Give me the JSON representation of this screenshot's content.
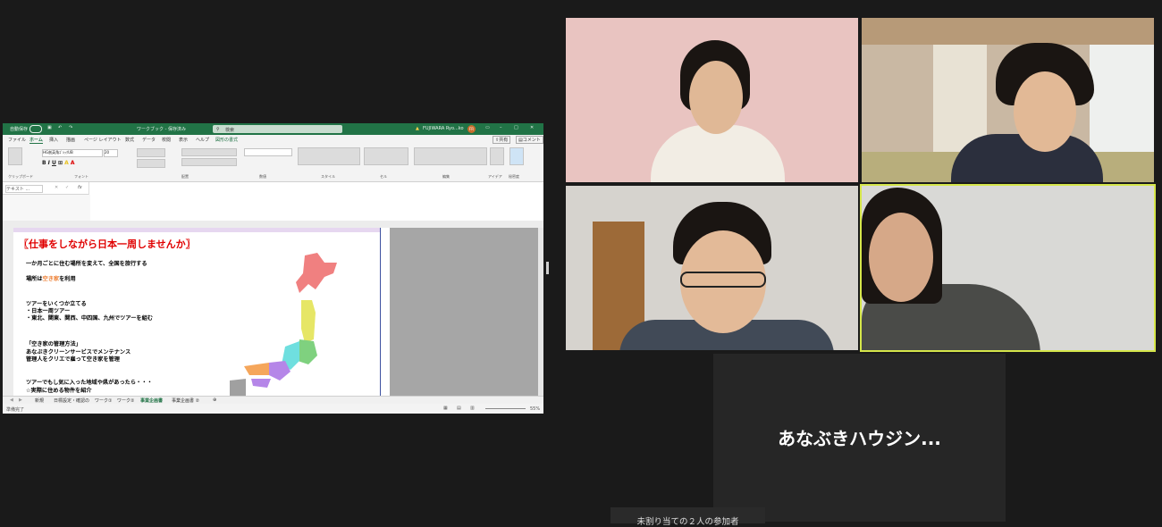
{
  "excel": {
    "autosave_label": "自動保存",
    "doc_title": "ワークブック - 保存済み",
    "search_placeholder": "検索",
    "user_name": "FUJIWARA Ryo...ko",
    "user_initials": "FR",
    "menu_tabs": [
      "ファイル",
      "ホーム",
      "挿入",
      "描画",
      "ページ レイアウト",
      "数式",
      "データ",
      "校閲",
      "表示",
      "ヘルプ",
      "図形の書式"
    ],
    "active_tab": "ホーム",
    "share_label": "共有",
    "comment_label": "コメント",
    "font_name": "HG創英角ｺﾞｼｯｸUB",
    "font_size": "20",
    "ribbon_groups": [
      "クリップボード",
      "フォント",
      "配置",
      "数値",
      "スタイル",
      "セル",
      "編集",
      "アイデア",
      "秘密度"
    ],
    "name_box": "テキスト ...",
    "fx_label": "fx",
    "sheet_headline": "〖仕事をしながら日本一周しませんか〗",
    "lines": {
      "l1": "一か月ごとに住む場所を変えて、全国を旅行する",
      "l2a": "場所は",
      "l2b": "空き家",
      "l2c": "を利用",
      "l3": "ツアーをいくつか立てる",
      "l4": "・日本一周ツアー",
      "l5": "・東北、関東、関西、中四国、九州でツアーを組む",
      "l6": "「空き家の管理方法」",
      "l7": "あなぶきクリーンサービスでメンテナンス",
      "l8": "管理人をクリエで雇って空き家を管理",
      "l9": "ツアーでもし気に入った地域や県があったら・・・",
      "l10": "☆実際に住める物件を紹介"
    },
    "sheet_tabs": [
      "新規",
      "日標設定・確認の",
      "ワーク①",
      "ワーク②",
      "事業企画書",
      "事業企画書 ②"
    ],
    "active_sheet": "事業企画書",
    "status_left": "準備完了",
    "zoom": "55%"
  },
  "participants": {
    "name_only_tile": "あなぶきハウジン..."
  },
  "footer": {
    "unassigned": "未割り当ての２人の参加者"
  }
}
